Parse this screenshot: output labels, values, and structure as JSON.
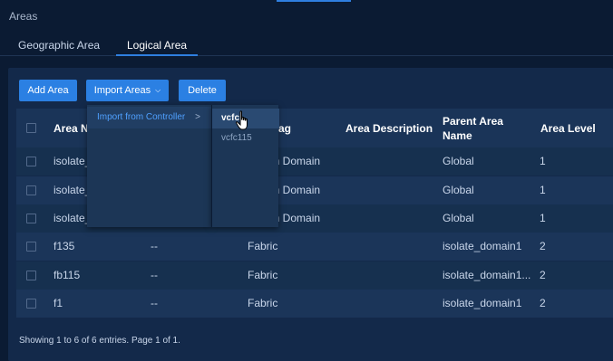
{
  "page": {
    "title": "Areas"
  },
  "tabs": [
    {
      "label": "Geographic Area",
      "active": false
    },
    {
      "label": "Logical Area",
      "active": true
    }
  ],
  "toolbar": {
    "add_label": "Add Area",
    "import_label": "Import Areas",
    "delete_label": "Delete"
  },
  "dropdown": {
    "item_label": "Import from Controller",
    "submenu": [
      "vcfc",
      "vcfc115"
    ]
  },
  "table": {
    "headers": {
      "name": "Area Name",
      "tag": "Area Tag",
      "description": "Area Description",
      "parent_line1": "Parent Area",
      "parent_line2": "Name",
      "level": "Area Level"
    },
    "visible_header_fragments": {
      "name": "Area N",
      "tag": "ag"
    },
    "rows": [
      {
        "name": "isolate_",
        "description": "",
        "tag": "on Domain",
        "parent": "Global",
        "level": "1"
      },
      {
        "name": "isolate_",
        "description": "",
        "tag": "on Domain",
        "parent": "Global",
        "level": "1"
      },
      {
        "name": "isolate_",
        "description": "",
        "tag": "on Domain",
        "parent": "Global",
        "level": "1"
      },
      {
        "name": "f135",
        "description": "--",
        "tag": "Fabric",
        "parent": "isolate_domain1",
        "level": "2"
      },
      {
        "name": "fb115",
        "description": "--",
        "tag": "Fabric",
        "parent": "isolate_domain1...",
        "level": "2"
      },
      {
        "name": "f1",
        "description": "--",
        "tag": "Fabric",
        "parent": "isolate_domain1",
        "level": "2"
      }
    ]
  },
  "footer": {
    "summary": "Showing 1 to 6 of 6 entries.  Page 1 of 1."
  },
  "colors": {
    "accent": "#2b80e3",
    "background": "#0b1b33",
    "panel": "#13294a"
  },
  "icons": {
    "cursor": "hand-pointer-icon",
    "submenu_arrow": "chevron-right-icon",
    "import_arrow": "chevron-down-icon"
  }
}
